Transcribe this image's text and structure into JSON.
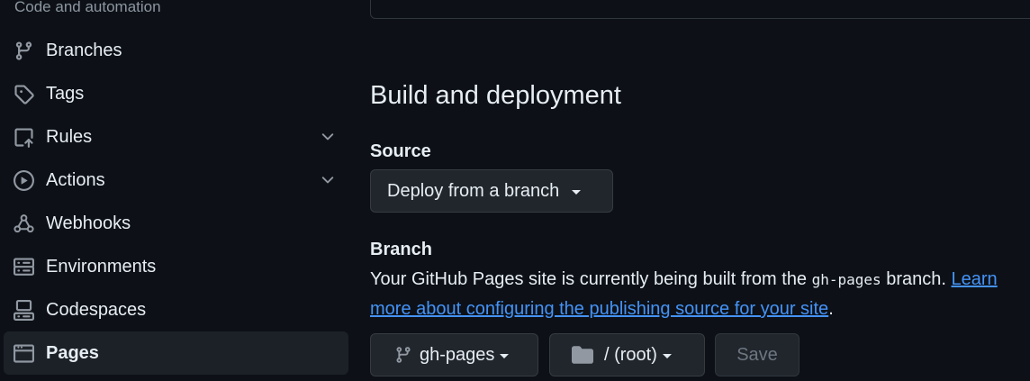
{
  "sidebar": {
    "section_heading": "Code and automation",
    "items": [
      {
        "label": "Branches",
        "icon": "git-branch-icon"
      },
      {
        "label": "Tags",
        "icon": "tag-icon"
      },
      {
        "label": "Rules",
        "icon": "rules-icon",
        "expandable": true
      },
      {
        "label": "Actions",
        "icon": "play-icon",
        "expandable": true
      },
      {
        "label": "Webhooks",
        "icon": "webhook-icon"
      },
      {
        "label": "Environments",
        "icon": "server-icon"
      },
      {
        "label": "Codespaces",
        "icon": "codespaces-icon"
      },
      {
        "label": "Pages",
        "icon": "browser-icon",
        "active": true
      }
    ]
  },
  "main": {
    "title": "Build and deployment",
    "source": {
      "label": "Source",
      "dropdown_value": "Deploy from a branch"
    },
    "branch": {
      "label": "Branch",
      "text_before": "Your GitHub Pages site is currently being built from the ",
      "code": "gh-pages",
      "text_after": " branch. ",
      "link": "Learn more about configuring the publishing source for your site",
      "period": ".",
      "branch_select": "gh-pages",
      "folder_select": "/ (root)",
      "save_label": "Save"
    }
  },
  "colors": {
    "background": "#0d1117",
    "text": "#e6edf3",
    "muted": "#8d96a0",
    "link": "#4493f8",
    "button_bg": "#21262d",
    "border": "#30363d",
    "active_item_bg": "#1c2128"
  }
}
